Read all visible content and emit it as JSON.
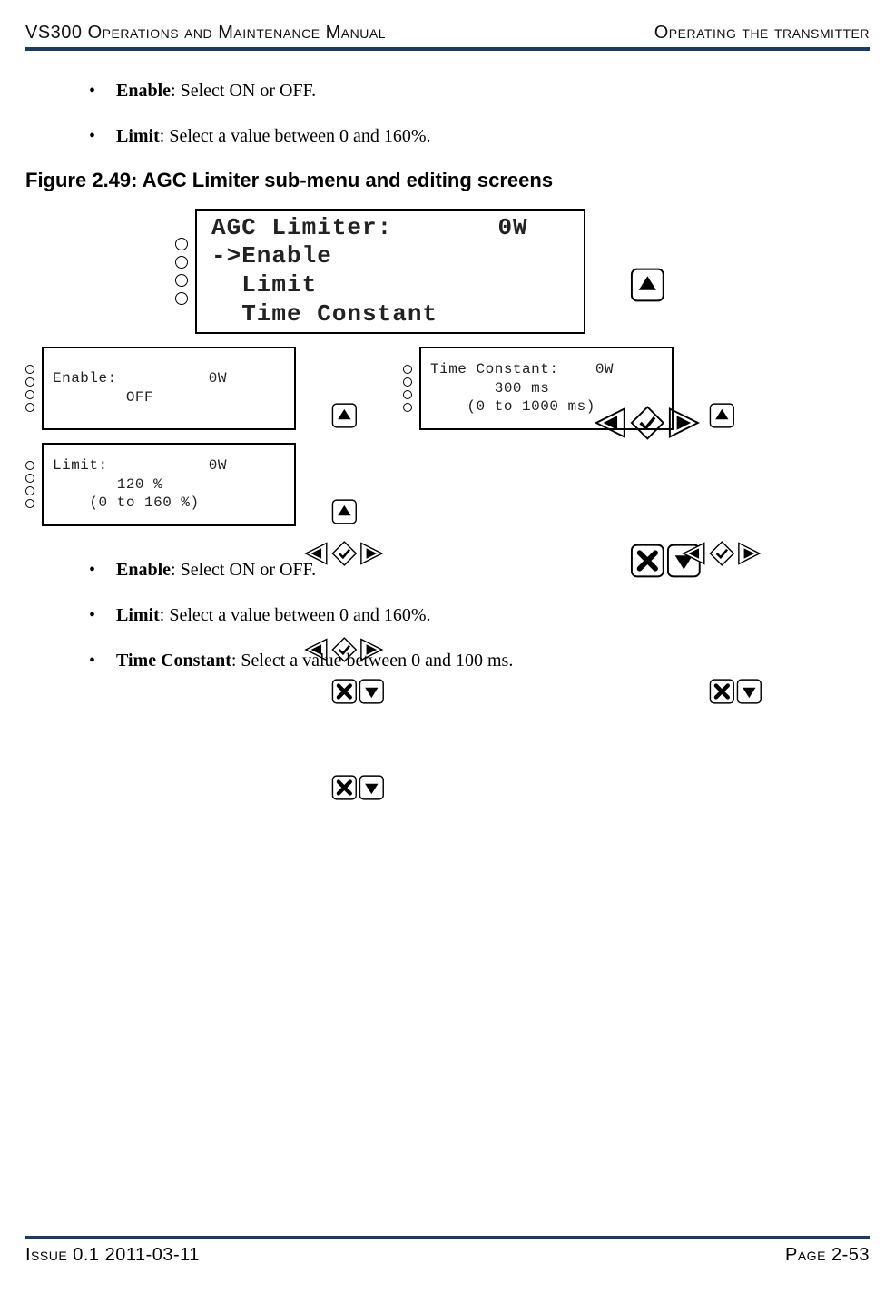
{
  "header": {
    "left": "VS300 Operations and Maintenance Manual",
    "right": "Operating the transmitter"
  },
  "top_bullets": [
    {
      "term": "Enable",
      "desc": ": Select ON or OFF."
    },
    {
      "term": "Limit",
      "desc": ": Select a value between 0 and 160%."
    }
  ],
  "figure_title": "Figure 2.49: AGC Limiter sub-menu and editing screens",
  "screens": {
    "main": {
      "line1": "AGC Limiter:       0W",
      "line2": "->Enable",
      "line3": "  Limit",
      "line4": "  Time Constant"
    },
    "enable": {
      "line1": "Enable:          0W",
      "line2": "",
      "line3": "        OFF"
    },
    "time_constant": {
      "line1": "Time Constant:    0W",
      "line2": "",
      "line3": "       300 ms",
      "line4": "    (0 to 1000 ms)"
    },
    "limit": {
      "line1": "Limit:           0W",
      "line2": "",
      "line3": "       120 %",
      "line4": "    (0 to 160 %)"
    }
  },
  "bottom_bullets": [
    {
      "term": "Enable",
      "desc": ": Select ON or OFF."
    },
    {
      "term": "Limit",
      "desc": ": Select a value between 0 and 160%."
    },
    {
      "term": "Time Constant",
      "desc": ": Select a value between 0 and 100 ms."
    }
  ],
  "footer": {
    "left": "Issue 0.1  2011-03-11",
    "right": "Page 2-53"
  }
}
